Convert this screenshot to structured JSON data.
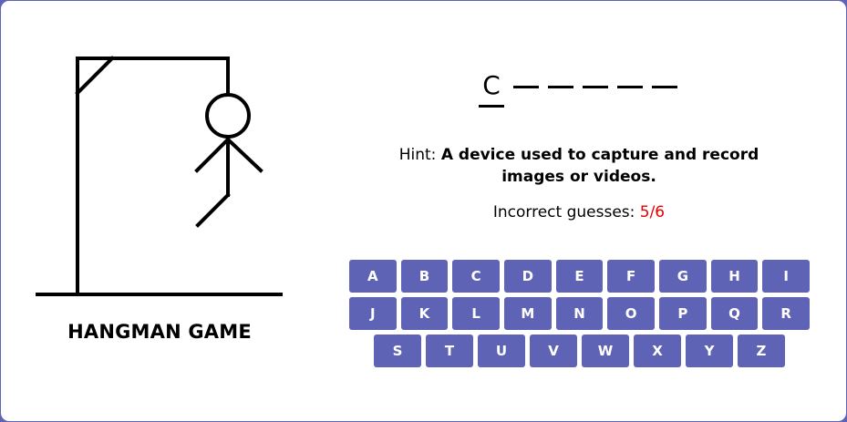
{
  "game": {
    "title": "HANGMAN GAME",
    "word_slots": [
      "C",
      "",
      "",
      "",
      "",
      ""
    ],
    "hint_label": "Hint:",
    "hint_text": "A device used to capture and record images or videos.",
    "incorrect_label": "Incorrect guesses:",
    "incorrect_count": "5/6"
  },
  "keyboard": {
    "rows": [
      [
        "A",
        "B",
        "C",
        "D",
        "E",
        "F",
        "G",
        "H",
        "I"
      ],
      [
        "J",
        "K",
        "L",
        "M",
        "N",
        "O",
        "P",
        "Q",
        "R"
      ],
      [
        "S",
        "T",
        "U",
        "V",
        "W",
        "X",
        "Y",
        "Z"
      ]
    ]
  },
  "colors": {
    "accent": "#5e63b6",
    "warning": "#e60000"
  }
}
